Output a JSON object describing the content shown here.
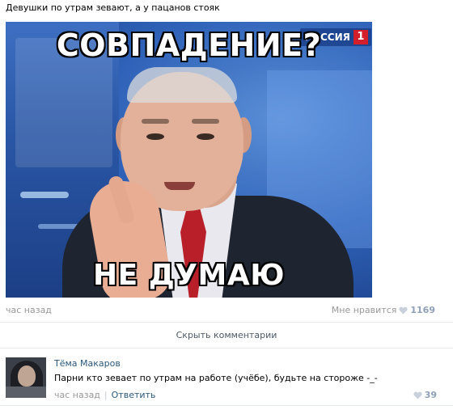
{
  "post": {
    "text": "Девушки по утрам зевают, а у пацанов стояк",
    "image": {
      "caption_top": "СОВПАДЕНИЕ?",
      "caption_bottom": "НЕ ДУМАЮ",
      "channel_logo_text": "РОССИЯ",
      "channel_logo_number": "1"
    },
    "time": "час назад",
    "like_label": "Мне нравится",
    "like_count": "1169"
  },
  "comments_toggle": "Скрыть комментарии",
  "comment": {
    "author": "Тёма Макаров",
    "text": "Парни кто зевает по утрам на работе (учёбе), будьте на стороже -_-",
    "time": "час назад",
    "separator": "|",
    "reply_label": "Ответить",
    "like_count": "39"
  },
  "colors": {
    "link": "#2b587a",
    "muted": "#999999",
    "like_count": "#8f9fb8",
    "heart": "#c7d0db",
    "logo_red": "#d21f2b"
  },
  "icons": {
    "like": "heart-icon"
  }
}
